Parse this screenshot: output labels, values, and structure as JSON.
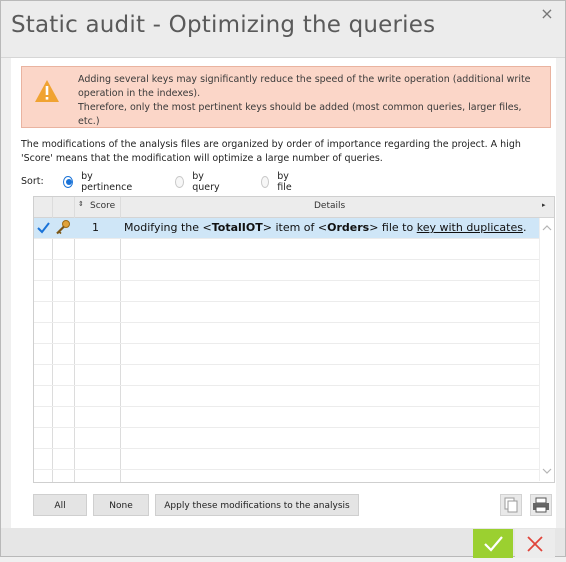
{
  "dialog": {
    "title": "Static audit - Optimizing the queries",
    "close_symbol": "×"
  },
  "warning": {
    "icon": "warning-triangle-icon",
    "line1": "Adding several keys may significantly reduce the speed of the write operation (additional write",
    "line2": "operation in the indexes).",
    "line3": "Therefore, only the most pertinent keys should be added (most common queries, larger files, etc.)"
  },
  "description": {
    "line1": "The modifications of the analysis files are organized by order of importance regarding the project. A high",
    "line2": "'Score' means that the modification will optimize a large number of queries."
  },
  "sort": {
    "label": "Sort:",
    "options": [
      "by pertinence",
      "by query",
      "by file"
    ],
    "selected": "by pertinence"
  },
  "table": {
    "headers": {
      "score": "Score",
      "details": "Details"
    },
    "rows": [
      {
        "checked": true,
        "icon": "key-icon",
        "score": "1",
        "details_prefix": "Modifying the <",
        "item": "TotalIOT",
        "details_mid": "> item of <",
        "file": "Orders",
        "details_mid2": "> file to ",
        "link": "key with duplicates",
        "details_suffix": "."
      }
    ]
  },
  "buttons": {
    "all": "All",
    "none": "None",
    "apply": "Apply these modifications to the analysis"
  },
  "colors": {
    "warning_bg": "#fbd6c8",
    "selected_row": "#cfe6f7",
    "ok_green": "#9bd030",
    "cancel_red": "#e0443a",
    "radio_blue": "#1a73d8"
  }
}
